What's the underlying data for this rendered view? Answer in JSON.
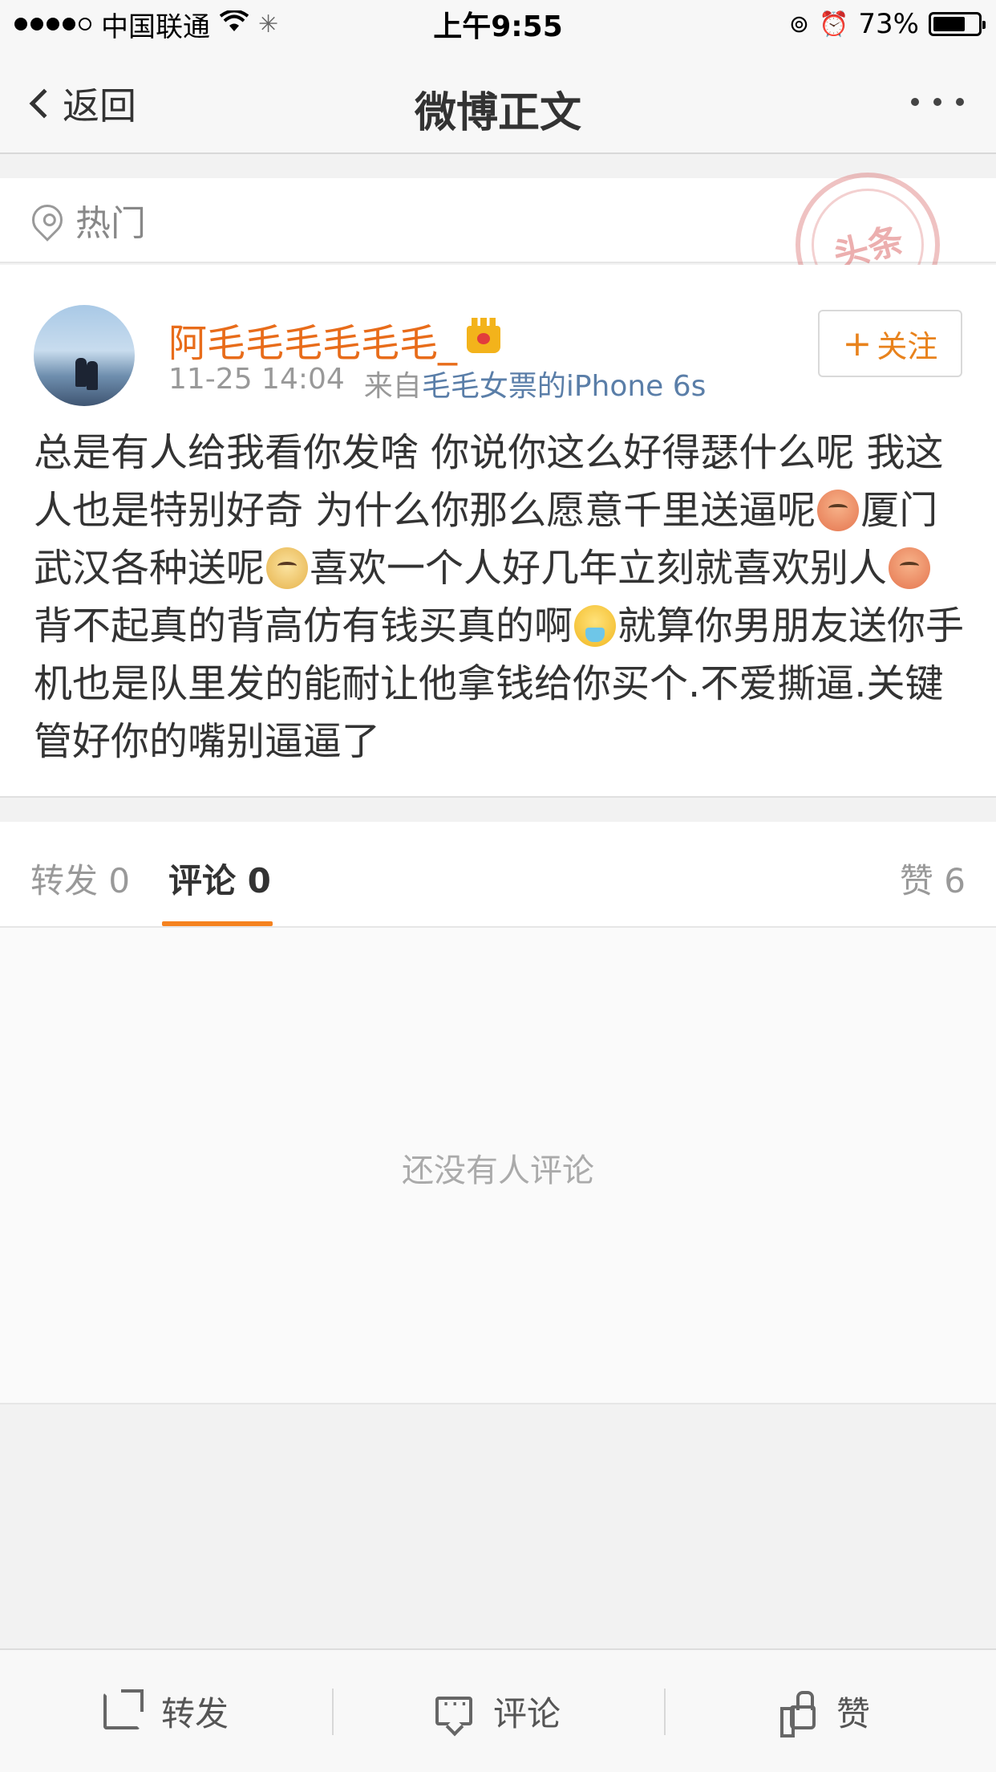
{
  "status_bar": {
    "carrier": "中国联通",
    "time": "上午9:55",
    "battery_percent": "73%",
    "battery_level": 0.73
  },
  "nav": {
    "back_label": "返回",
    "title": "微博正文"
  },
  "hot": {
    "label": "热门",
    "stamp_text": "头条"
  },
  "post": {
    "author": "阿毛毛毛毛毛毛_",
    "timestamp": "11-25 14:04",
    "source_prefix": "来自",
    "source": "毛毛女票的iPhone 6s",
    "follow_label": "关注",
    "text_segments": [
      "总是有人给我看你发啥 你说你这么好得瑟什么呢 我这人也是特别好奇 为什么你那么愿意千里送逼呢",
      "厦门武汉各种送呢",
      "喜欢一个人好几年立刻就喜欢别人",
      "背不起真的背高仿有钱买真的啊",
      "就算你男朋友送你手机也是队里发的能耐让他拿钱给你买个.不爱撕逼.关键管好你的嘴别逼逼了"
    ],
    "emojis": [
      "shy-emoji",
      "doge-emoji",
      "shy-emoji",
      "sick-emoji"
    ]
  },
  "tabs": {
    "reposts": "转发 0",
    "comments": "评论 0",
    "likes": "赞 6"
  },
  "comments": {
    "empty_text": "还没有人评论"
  },
  "toolbar": {
    "repost_label": "转发",
    "comment_label": "评论",
    "like_label": "赞"
  },
  "colors": {
    "accent": "#f5821f",
    "username": "#e86c1a",
    "link": "#5a7ea8"
  }
}
